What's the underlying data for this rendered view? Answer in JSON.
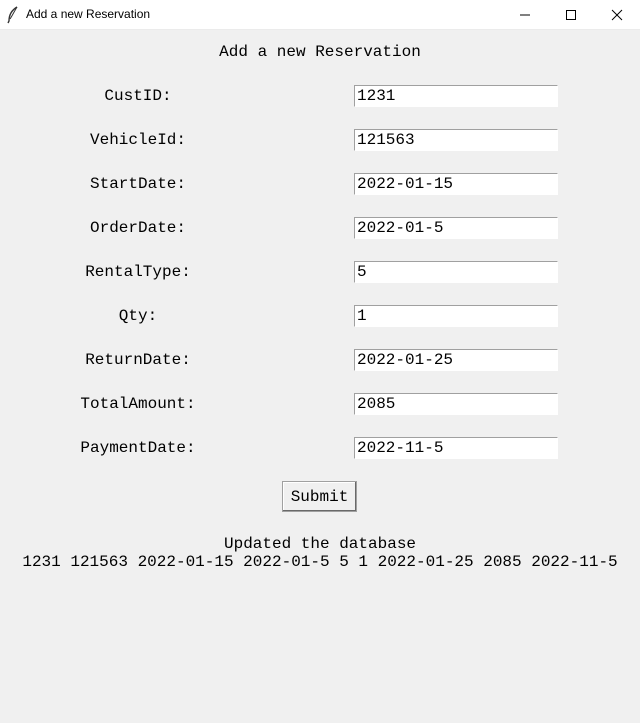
{
  "window": {
    "title": "Add a new Reservation",
    "icon": "feather-icon"
  },
  "form": {
    "heading": "Add a new Reservation",
    "fields": [
      {
        "label": "CustID:",
        "value": "1231"
      },
      {
        "label": "VehicleId:",
        "value": "121563"
      },
      {
        "label": "StartDate:",
        "value": "2022-01-15"
      },
      {
        "label": "OrderDate:",
        "value": "2022-01-5"
      },
      {
        "label": "RentalType:",
        "value": "5"
      },
      {
        "label": "Qty:",
        "value": "1"
      },
      {
        "label": "ReturnDate:",
        "value": "2022-01-25"
      },
      {
        "label": "TotalAmount:",
        "value": "2085"
      },
      {
        "label": "PaymentDate:",
        "value": "2022-11-5"
      }
    ],
    "submit_label": "Submit"
  },
  "status": {
    "message": "Updated the database",
    "result": "1231 121563 2022-01-15 2022-01-5 5 1 2022-01-25 2085 2022-11-5"
  }
}
